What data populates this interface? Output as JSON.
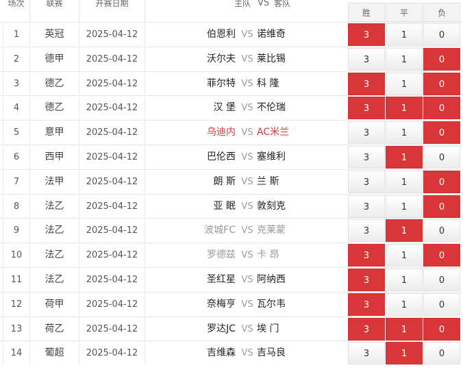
{
  "header": {
    "no_label": "场次",
    "league_label": "联赛",
    "date_label": "开赛日期",
    "home_label": "主队",
    "vs_label": "VS",
    "away_label": "客队",
    "win_label": "胜",
    "draw_label": "平",
    "lose_label": "负"
  },
  "colors": {
    "selected": "#d9363a",
    "hot_team": "#d9363a",
    "muted_team": "#9a9a9a"
  },
  "rows": [
    {
      "no": "1",
      "league": "英冠",
      "date": "2025-04-12",
      "home": "伯恩利",
      "vs": "VS",
      "away": "诺维奇",
      "odds": [
        "3",
        "1",
        "0"
      ],
      "selected": [
        true,
        false,
        false
      ],
      "team_style": "normal"
    },
    {
      "no": "2",
      "league": "德甲",
      "date": "2025-04-12",
      "home": "沃尔夫",
      "vs": "VS",
      "away": "莱比锡",
      "odds": [
        "3",
        "1",
        "0"
      ],
      "selected": [
        false,
        false,
        true
      ],
      "team_style": "normal"
    },
    {
      "no": "3",
      "league": "德乙",
      "date": "2025-04-12",
      "home": "菲尔特",
      "vs": "VS",
      "away": "科 隆",
      "odds": [
        "3",
        "1",
        "0"
      ],
      "selected": [
        true,
        false,
        true
      ],
      "team_style": "normal"
    },
    {
      "no": "4",
      "league": "德乙",
      "date": "2025-04-12",
      "home": "汉 堡",
      "vs": "VS",
      "away": "不伦瑞",
      "odds": [
        "3",
        "1",
        "0"
      ],
      "selected": [
        true,
        true,
        true
      ],
      "team_style": "normal"
    },
    {
      "no": "5",
      "league": "意甲",
      "date": "2025-04-12",
      "home": "乌迪内",
      "vs": "VS",
      "away": "AC米兰",
      "odds": [
        "3",
        "1",
        "0"
      ],
      "selected": [
        false,
        false,
        true
      ],
      "team_style": "hot"
    },
    {
      "no": "6",
      "league": "西甲",
      "date": "2025-04-12",
      "home": "巴伦西",
      "vs": "VS",
      "away": "塞维利",
      "odds": [
        "3",
        "1",
        "0"
      ],
      "selected": [
        false,
        true,
        false
      ],
      "team_style": "normal"
    },
    {
      "no": "7",
      "league": "法甲",
      "date": "2025-04-12",
      "home": "朗 斯",
      "vs": "VS",
      "away": "兰 斯",
      "odds": [
        "3",
        "1",
        "0"
      ],
      "selected": [
        false,
        false,
        true
      ],
      "team_style": "normal"
    },
    {
      "no": "8",
      "league": "法乙",
      "date": "2025-04-12",
      "home": "亚 眠",
      "vs": "VS",
      "away": "敦刻克",
      "odds": [
        "3",
        "1",
        "0"
      ],
      "selected": [
        false,
        false,
        true
      ],
      "team_style": "normal"
    },
    {
      "no": "9",
      "league": "法乙",
      "date": "2025-04-12",
      "home": "波城FC",
      "vs": "VS",
      "away": "克莱蒙",
      "odds": [
        "3",
        "1",
        "0"
      ],
      "selected": [
        false,
        true,
        false
      ],
      "team_style": "muted"
    },
    {
      "no": "10",
      "league": "法乙",
      "date": "2025-04-12",
      "home": "罗德兹",
      "vs": "VS",
      "away": "卡 昂",
      "odds": [
        "3",
        "1",
        "0"
      ],
      "selected": [
        true,
        false,
        true
      ],
      "team_style": "muted"
    },
    {
      "no": "11",
      "league": "法乙",
      "date": "2025-04-12",
      "home": "圣红星",
      "vs": "VS",
      "away": "阿纳西",
      "odds": [
        "3",
        "1",
        "0"
      ],
      "selected": [
        true,
        false,
        false
      ],
      "team_style": "normal"
    },
    {
      "no": "12",
      "league": "荷甲",
      "date": "2025-04-12",
      "home": "奈梅亨",
      "vs": "VS",
      "away": "瓦尔韦",
      "odds": [
        "3",
        "1",
        "0"
      ],
      "selected": [
        true,
        false,
        false
      ],
      "team_style": "normal"
    },
    {
      "no": "13",
      "league": "荷乙",
      "date": "2025-04-12",
      "home": "罗达JC",
      "vs": "VS",
      "away": "埃 门",
      "odds": [
        "3",
        "1",
        "0"
      ],
      "selected": [
        true,
        true,
        true
      ],
      "team_style": "normal"
    },
    {
      "no": "14",
      "league": "葡超",
      "date": "2025-04-12",
      "home": "吉维森",
      "vs": "VS",
      "away": "吉马良",
      "odds": [
        "3",
        "1",
        "0"
      ],
      "selected": [
        false,
        true,
        false
      ],
      "team_style": "normal"
    }
  ]
}
